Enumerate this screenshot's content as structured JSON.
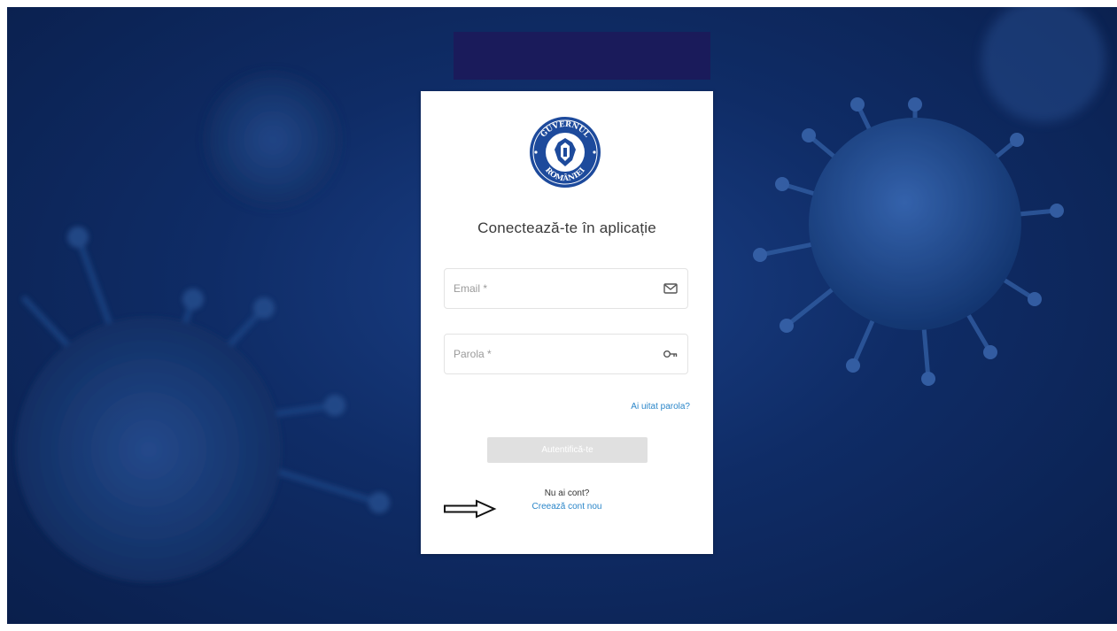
{
  "login": {
    "title": "Conectează-te în aplicație",
    "email_placeholder": "Email *",
    "password_placeholder": "Parola *",
    "forgot_link": "Ai uitat parola?",
    "submit_label": "Autentifică-te",
    "no_account_text": "Nu ai cont?",
    "create_account_link": "Creează cont nou"
  },
  "logo": {
    "icon": "government-seal-icon",
    "text_top": "GUVERNUL",
    "text_bottom": "ROMÂNIEI"
  },
  "colors": {
    "background": "#0f2c66",
    "link": "#2a86c9",
    "button_disabled": "#e0e0e0",
    "seal": "#1d4a9c"
  },
  "icons": {
    "email": "envelope-icon",
    "password": "key-icon",
    "annotation": "arrow-right-icon"
  }
}
